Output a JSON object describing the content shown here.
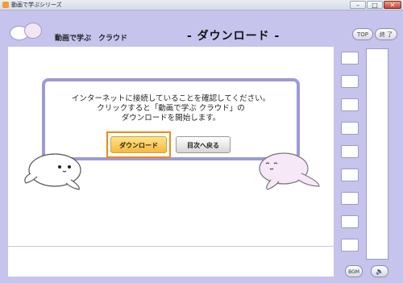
{
  "window": {
    "title": "動画で学ぶシリーズ",
    "minimize": "–",
    "maximize": "□",
    "close": "✕"
  },
  "header": {
    "app_name": "動画で学ぶ　クラウド",
    "page_title": "- ダウンロード -",
    "top_label": "TOP",
    "exit_label": "終 了"
  },
  "dialog": {
    "message_line1": "インターネットに接続していることを確認してください。",
    "message_line2": "クリックすると「動画で学ぶ クラウド」の",
    "message_line3": "ダウンロードを開始します。",
    "download_label": "ダウンロード",
    "toc_label": "目次へ戻る"
  },
  "footer": {
    "bgm_label": "BGM",
    "speaker_icon": "speaker-icon"
  },
  "colors": {
    "frame": "#c6c4ec",
    "dialog_border": "#9d9ad8",
    "highlight": "#ef8a10",
    "download_button": "#f7b93a"
  }
}
